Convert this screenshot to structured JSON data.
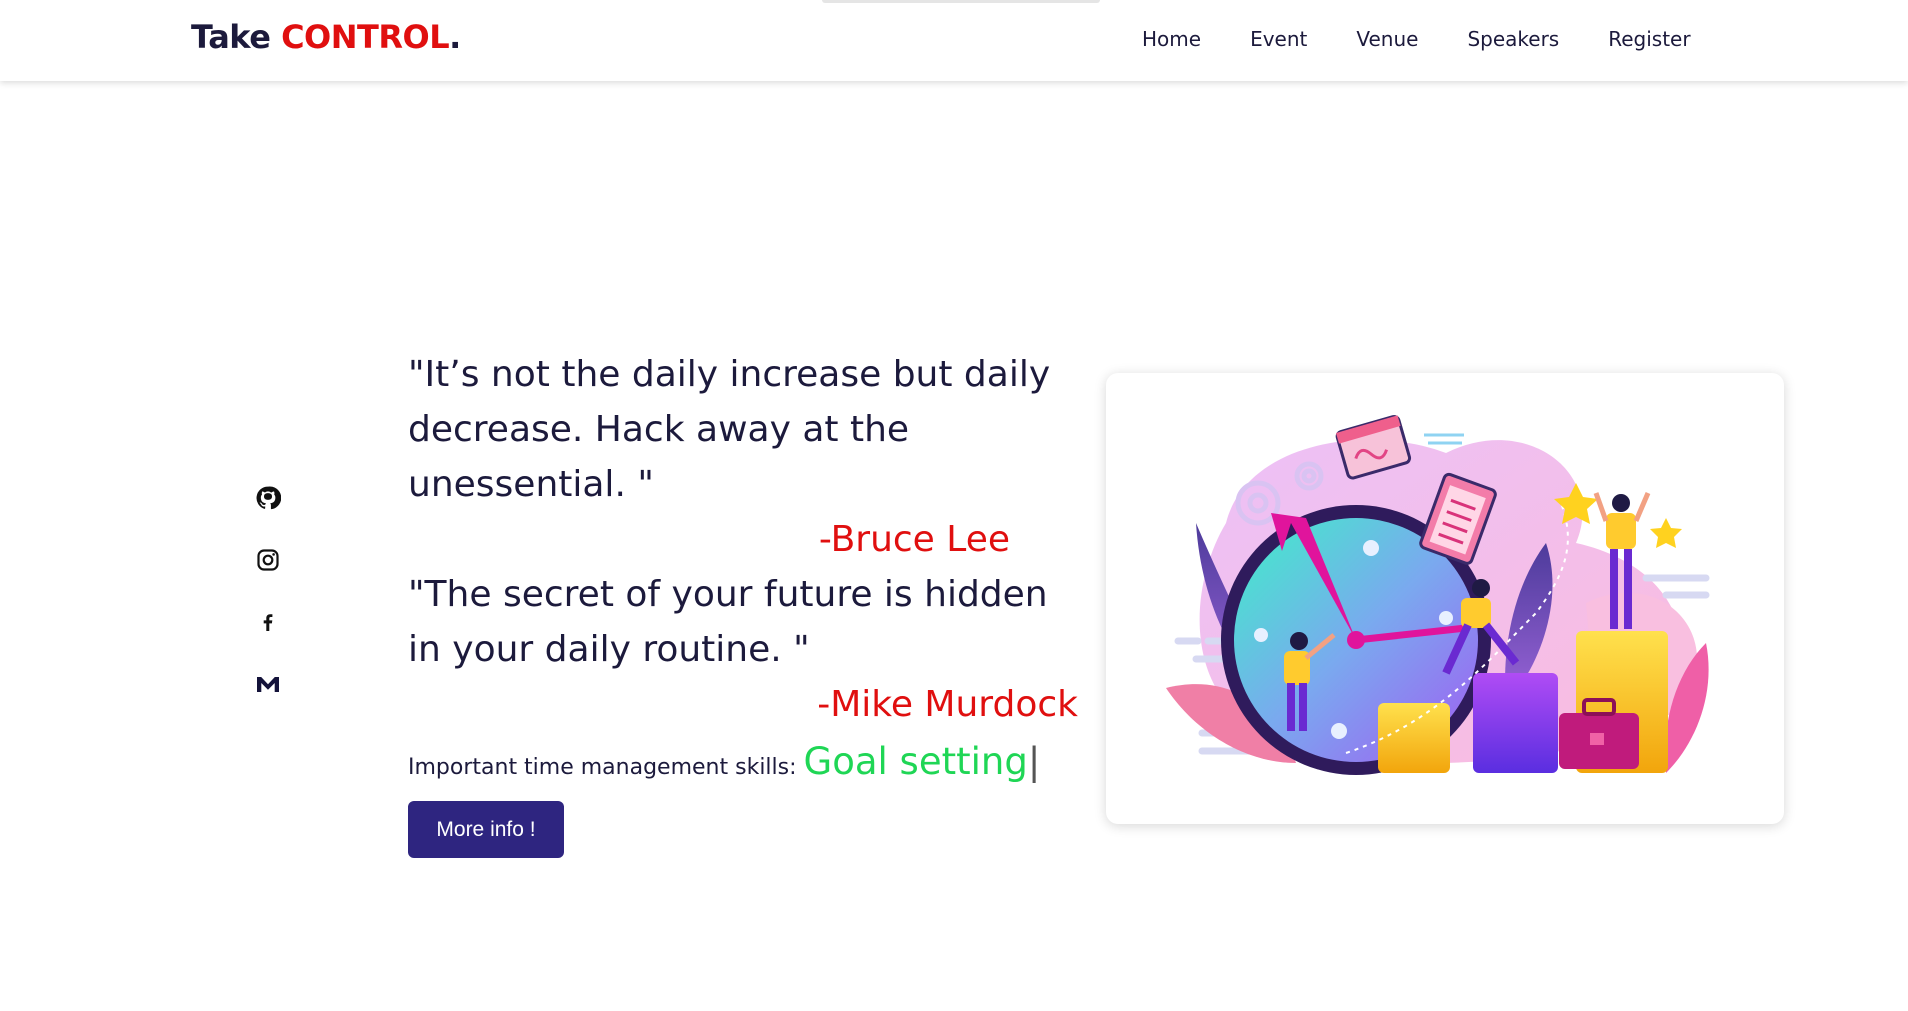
{
  "header": {
    "brand_main": "Take ",
    "brand_accent": "CONTROL",
    "brand_dot": ".",
    "nav": [
      "Home",
      "Event",
      "Venue",
      "Speakers",
      "Register"
    ]
  },
  "social": {
    "icons": [
      "github-icon",
      "instagram-icon",
      "facebook-icon",
      "gmail-icon"
    ]
  },
  "hero": {
    "quote1": "\"It’s not the daily increase but daily decrease. Hack away at the unessential. \"",
    "author1": "-Bruce Lee",
    "quote2": "\"The secret of your future is hidden in your daily routine. \"",
    "author2": "-Mike Murdock",
    "skills_label": "Important time management skills: ",
    "skills_typed": "Goal setting",
    "skills_caret": "|",
    "button": "More info !"
  },
  "colors": {
    "accent_red": "#e00f0f",
    "typed_green": "#1fd655",
    "button_bg": "#2e2580",
    "text_dark": "#1c1a3c"
  }
}
